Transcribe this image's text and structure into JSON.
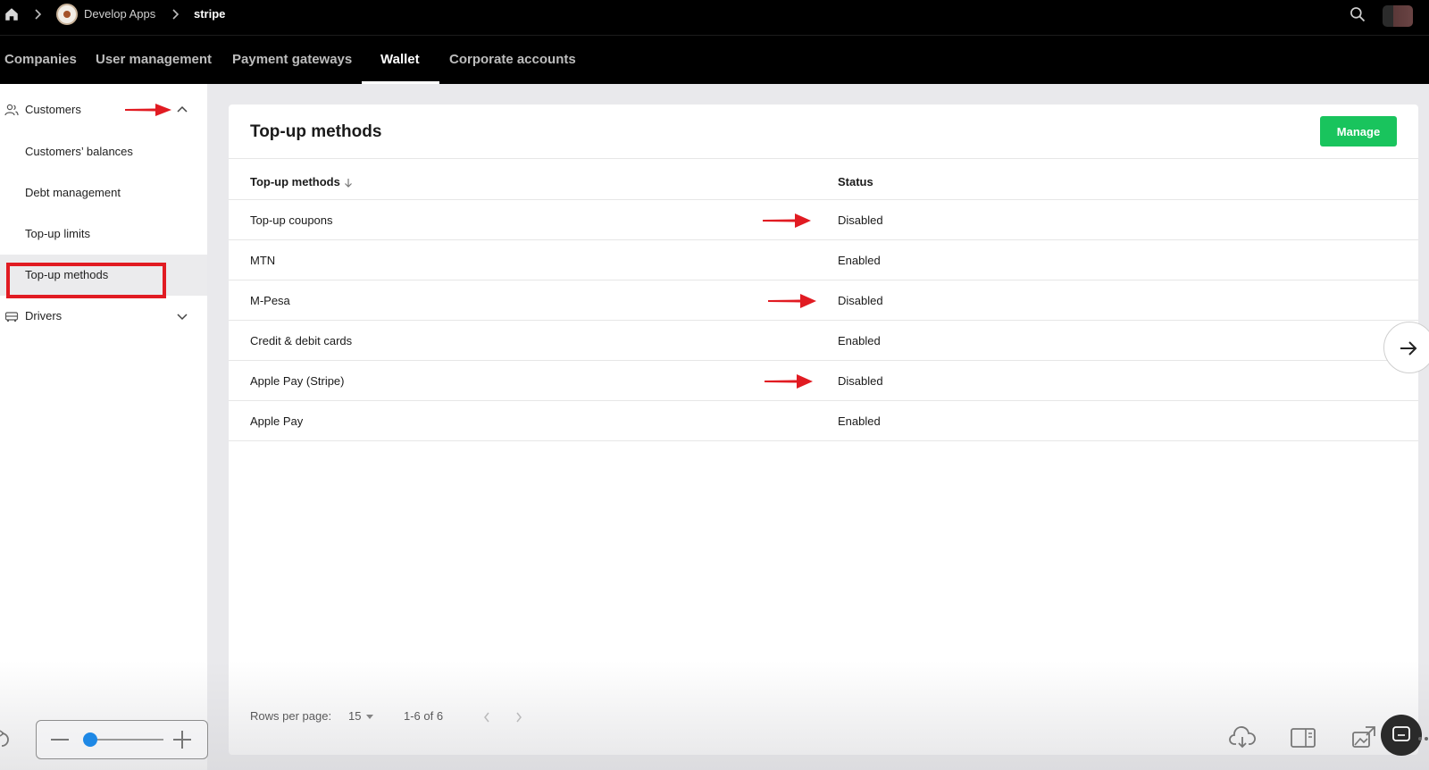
{
  "breadcrumb": {
    "home_icon": "home-icon",
    "app_name": "Develop Apps",
    "current": "stripe"
  },
  "tabs": [
    {
      "label": "Companies"
    },
    {
      "label": "User management"
    },
    {
      "label": "Payment gateways"
    },
    {
      "label": "Wallet",
      "active": true
    },
    {
      "label": "Corporate accounts"
    }
  ],
  "sidebar": {
    "groups": [
      {
        "label": "Customers",
        "icon": "users-icon",
        "expanded": true,
        "items": [
          {
            "label": "Customers’ balances"
          },
          {
            "label": "Debt management"
          },
          {
            "label": "Top-up limits"
          },
          {
            "label": "Top-up methods",
            "active": true
          }
        ]
      },
      {
        "label": "Drivers",
        "icon": "car-icon",
        "expanded": false
      }
    ]
  },
  "main": {
    "title": "Top-up methods",
    "manage_label": "Manage",
    "columns": [
      "Top-up methods",
      "Status"
    ],
    "rows": [
      {
        "method": "Top-up coupons",
        "status": "Disabled"
      },
      {
        "method": "MTN",
        "status": "Enabled"
      },
      {
        "method": "M-Pesa",
        "status": "Disabled"
      },
      {
        "method": "Credit & debit cards",
        "status": "Enabled"
      },
      {
        "method": "Apple Pay (Stripe)",
        "status": "Disabled"
      },
      {
        "method": "Apple Pay",
        "status": "Enabled"
      }
    ],
    "footer": {
      "rows_per_page_label": "Rows per page:",
      "rows_per_page_value": "15",
      "range": "1-6 of 6"
    }
  },
  "colors": {
    "accent_green": "#19c45d",
    "annotation_red": "#e11b22",
    "topbar": "#000000"
  }
}
